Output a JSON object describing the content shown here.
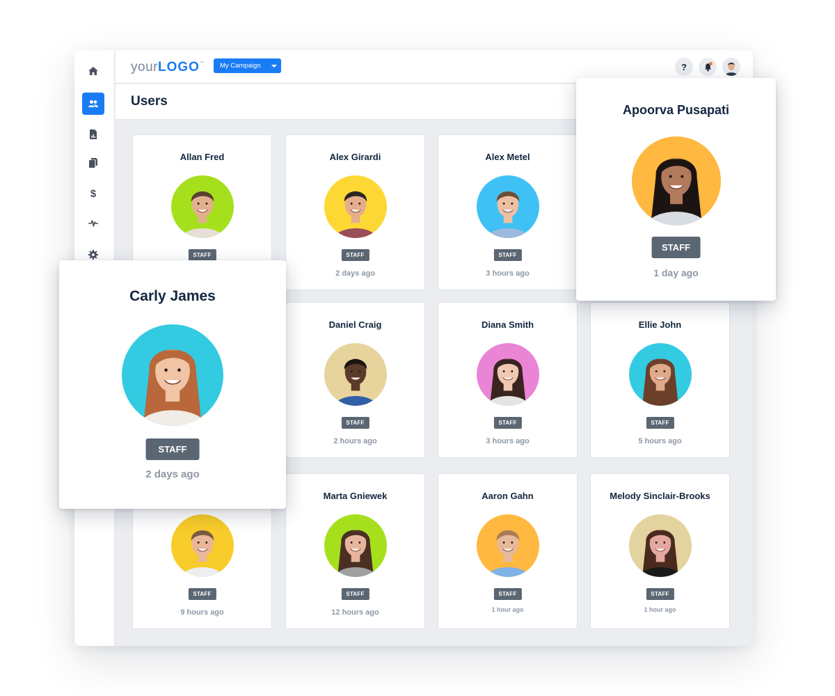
{
  "app": {
    "logo": {
      "prefix": "your",
      "brand": "LOGO",
      "tm": "™"
    },
    "campaign_select": {
      "value": "My Campaign"
    },
    "header": {
      "help_label": "?"
    },
    "page_title": "Users"
  },
  "sidebar": {
    "items": [
      {
        "name": "home",
        "icon": "home-icon",
        "active": false
      },
      {
        "name": "users",
        "icon": "users-icon",
        "active": true
      },
      {
        "name": "reports",
        "icon": "report-chart-icon",
        "active": false
      },
      {
        "name": "documents",
        "icon": "copy-documents-icon",
        "active": false
      },
      {
        "name": "billing",
        "icon": "dollar-icon",
        "active": false
      },
      {
        "name": "activity",
        "icon": "pulse-icon",
        "active": false
      },
      {
        "name": "settings",
        "icon": "gear-icon",
        "active": false
      }
    ]
  },
  "colors": {
    "accent": "#1a7cf4",
    "badge": "#5b6673",
    "notification_dot": "#f07a3a",
    "title": "#12263f",
    "muted": "#8e97a4",
    "canvas": "#ebedf1"
  },
  "users": [
    {
      "name": "Allan Fred",
      "role": "STAFF",
      "last_seen": "",
      "avatar_bg": "#a6e01d",
      "skin": "#e2b08f",
      "hair": "#5b4030",
      "shirt": "#e6dfd6"
    },
    {
      "name": "Alex Girardi",
      "role": "STAFF",
      "last_seen": "2 days ago",
      "avatar_bg": "#fdd835",
      "skin": "#e4ae8c",
      "hair": "#2c2420",
      "shirt": "#9a4e5a"
    },
    {
      "name": "Alex Metel",
      "role": "STAFF",
      "last_seen": "3 hours ago",
      "avatar_bg": "#3fc1f5",
      "skin": "#edc0a4",
      "hair": "#6d4d36",
      "shirt": "#9cb8dc"
    },
    {
      "name": "Daniel Craig",
      "role": "STAFF",
      "last_seen": "2 hours ago",
      "avatar_bg": "#e6d49c",
      "skin": "#5a3a28",
      "hair": "#1d1410",
      "shirt": "#2f5fa6"
    },
    {
      "name": "Diana Smith",
      "role": "STAFF",
      "last_seen": "3 hours ago",
      "avatar_bg": "#ea85d6",
      "skin": "#f0c8b2",
      "hair": "#3a2420",
      "shirt": "#e4e4e4"
    },
    {
      "name": "Ellie John",
      "role": "STAFF",
      "last_seen": "5 hours ago",
      "avatar_bg": "#33cbe2",
      "skin": "#dfa98a",
      "hair": "#6b3f2a",
      "shirt": "#6b3f2a"
    },
    {
      "name": "",
      "role": "STAFF",
      "last_seen": "9 hours ago",
      "avatar_bg": "#f8cc2a",
      "skin": "#e9b699",
      "hair": "#7a5a40",
      "shirt": "#eeeeee"
    },
    {
      "name": "Marta Gniewek",
      "role": "STAFF",
      "last_seen": "12 hours ago",
      "avatar_bg": "#a6e01d",
      "skin": "#e7b59c",
      "hair": "#4a3024",
      "shirt": "#a0a0a0"
    },
    {
      "name": "Aaron Gahn",
      "role": "STAFF",
      "last_seen": "1 hour ago",
      "avatar_bg": "#ffb840",
      "skin": "#e8b89a",
      "hair": "#a87a55",
      "shirt": "#7fb2e6"
    },
    {
      "name": "Melody Sinclair-Brooks",
      "role": "STAFF",
      "last_seen": "1 hour ago",
      "avatar_bg": "#e3d39e",
      "skin": "#e3a8a0",
      "hair": "#4a2a1e",
      "shirt": "#1a1a1a"
    }
  ],
  "popups": {
    "carly": {
      "name": "Carly James",
      "role": "STAFF",
      "last_seen": "2 days ago",
      "avatar_bg": "#33cbe2",
      "skin": "#f1c4a6",
      "hair": "#b8683a",
      "shirt": "#f0ece6"
    },
    "apoorva": {
      "name": "Apoorva Pusapati",
      "role": "STAFF",
      "last_seen": "1 day ago",
      "avatar_bg": "#ffb840",
      "skin": "#b27a5c",
      "hair": "#1c1412",
      "shirt": "#d8dde4"
    }
  }
}
